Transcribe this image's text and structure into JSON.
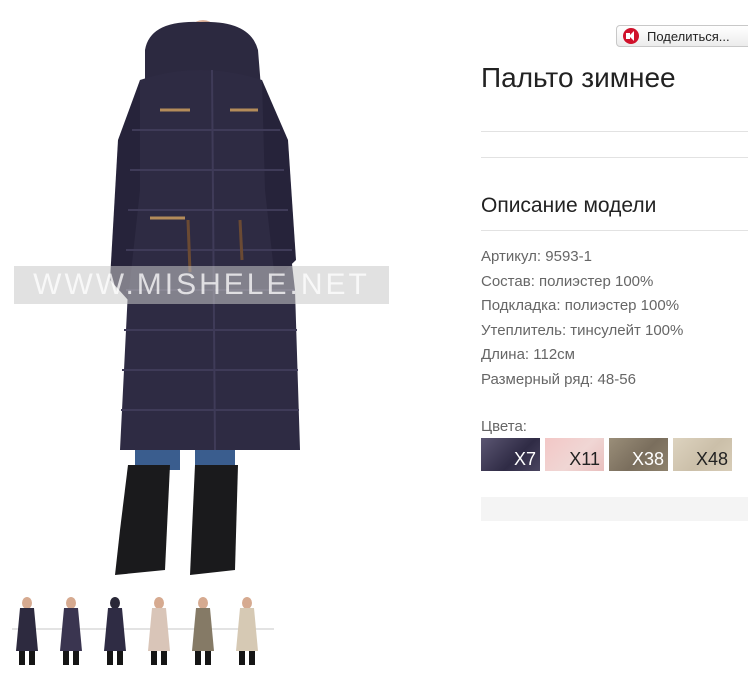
{
  "product": {
    "title": "Пальто зимнее",
    "image_watermark": "WWW.MISHELE.NET",
    "thumbnail_colors": [
      "#2d2a3f",
      "#3a3550",
      "#2f2c44",
      "#d9c5b8",
      "#857a66",
      "#d6c9b4"
    ]
  },
  "share": {
    "label": "Поделиться..."
  },
  "description": {
    "heading": "Описание модели",
    "specs": [
      "Артикул: 9593-1",
      "Состав: полиэстер 100%",
      "Подкладка: полиэстер 100%",
      "Утеплитель: тинсулейт 100%",
      "Длина: 112см",
      "Размерный ряд: 48-56"
    ]
  },
  "colors": {
    "label": "Цвета:",
    "swatches": [
      "X7",
      "X11",
      "X38",
      "X48"
    ]
  }
}
